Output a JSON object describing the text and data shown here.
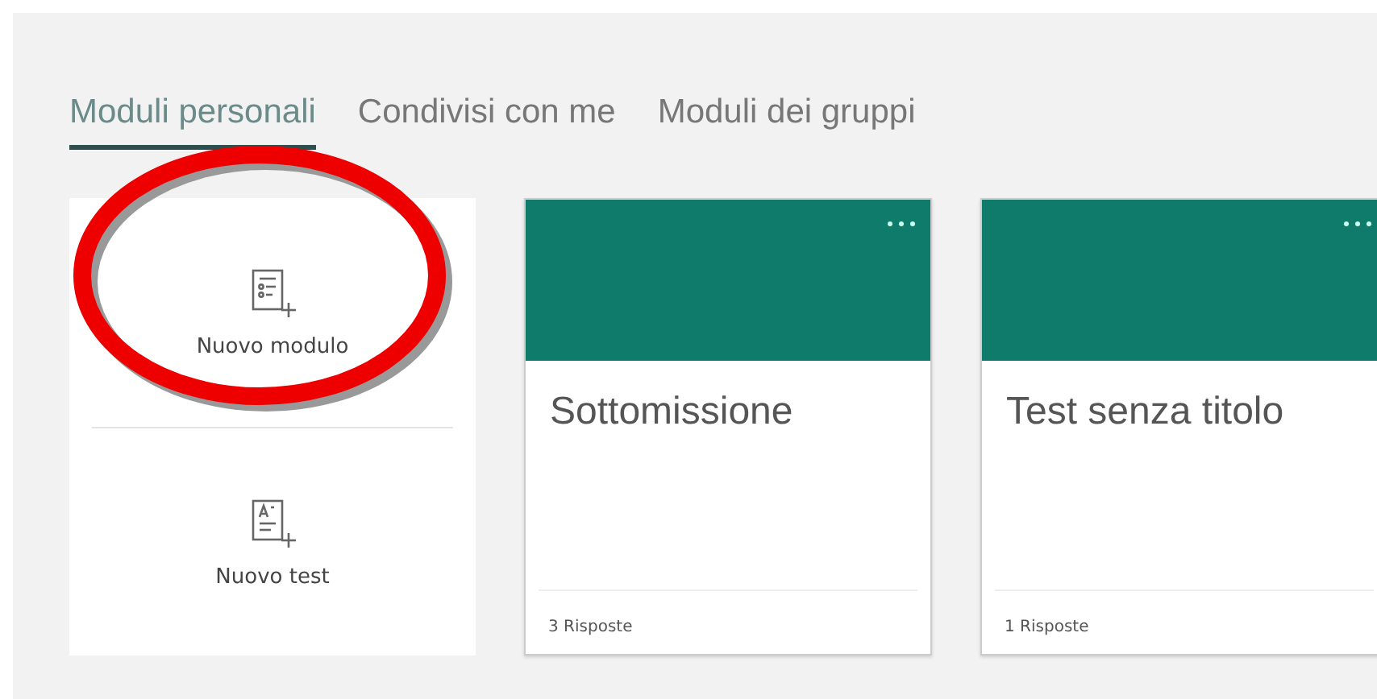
{
  "tabs": [
    {
      "label": "Moduli personali",
      "selected": true
    },
    {
      "label": "Condivisi con me",
      "selected": false
    },
    {
      "label": "Moduli dei gruppi",
      "selected": false
    }
  ],
  "new_actions": [
    {
      "kind": "form",
      "label": "Nuovo modulo",
      "highlighted": true
    },
    {
      "kind": "quiz",
      "label": "Nuovo test",
      "highlighted": false
    }
  ],
  "forms": [
    {
      "title": "Sottomissione",
      "responses": "3 Risposte"
    },
    {
      "title": "Test senza titolo",
      "responses": "1 Risposte"
    }
  ]
}
